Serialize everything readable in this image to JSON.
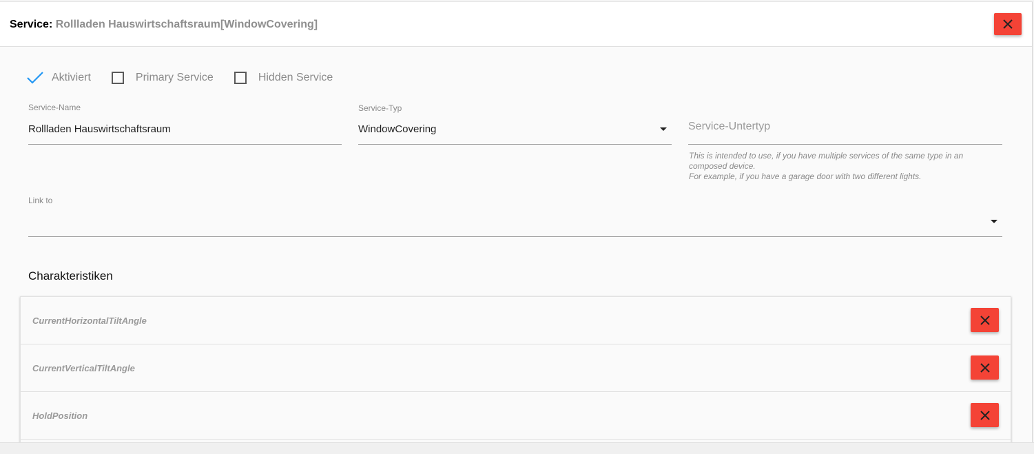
{
  "header": {
    "label": "Service:",
    "service_name": "Rollladen Hauswirtschaftsraum[WindowCovering]"
  },
  "checkboxes": [
    {
      "label": "Aktiviert",
      "checked": true
    },
    {
      "label": "Primary Service",
      "checked": false
    },
    {
      "label": "Hidden Service",
      "checked": false
    }
  ],
  "fields": {
    "service_name": {
      "label": "Service-Name",
      "value": "Rollladen Hauswirtschaftsraum"
    },
    "service_type": {
      "label": "Service-Typ",
      "value": "WindowCovering"
    },
    "service_subtype": {
      "placeholder": "Service-Untertyp",
      "hint_lines": [
        "This is intended to use, if you have multiple services of the same type in an",
        "composed device.",
        "For example, if you have a garage door with two different lights."
      ]
    },
    "link_to": {
      "label": "Link to",
      "value": ""
    }
  },
  "characteristics": {
    "title": "Charakteristiken",
    "items": [
      {
        "name": "CurrentHorizontalTiltAngle"
      },
      {
        "name": "CurrentVerticalTiltAngle"
      },
      {
        "name": "HoldPosition"
      }
    ]
  },
  "colors": {
    "danger": "#f44336",
    "accent": "#2196f3"
  },
  "icons": {
    "close": "close-icon",
    "check": "check-icon",
    "dropdown": "caret-down-icon"
  }
}
